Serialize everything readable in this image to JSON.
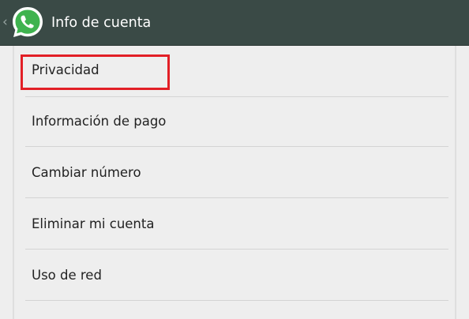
{
  "header": {
    "back_glyph": "‹",
    "logo_icon": "whatsapp-logo-icon",
    "title": "Info de cuenta",
    "background_color": "#3a4a46"
  },
  "menu": {
    "items": [
      {
        "label": "Privacidad"
      },
      {
        "label": "Información de pago"
      },
      {
        "label": "Cambiar número"
      },
      {
        "label": "Eliminar mi cuenta"
      },
      {
        "label": "Uso de red"
      }
    ]
  },
  "annotation": {
    "highlighted_item": "Privacidad",
    "color": "#e21f26"
  }
}
